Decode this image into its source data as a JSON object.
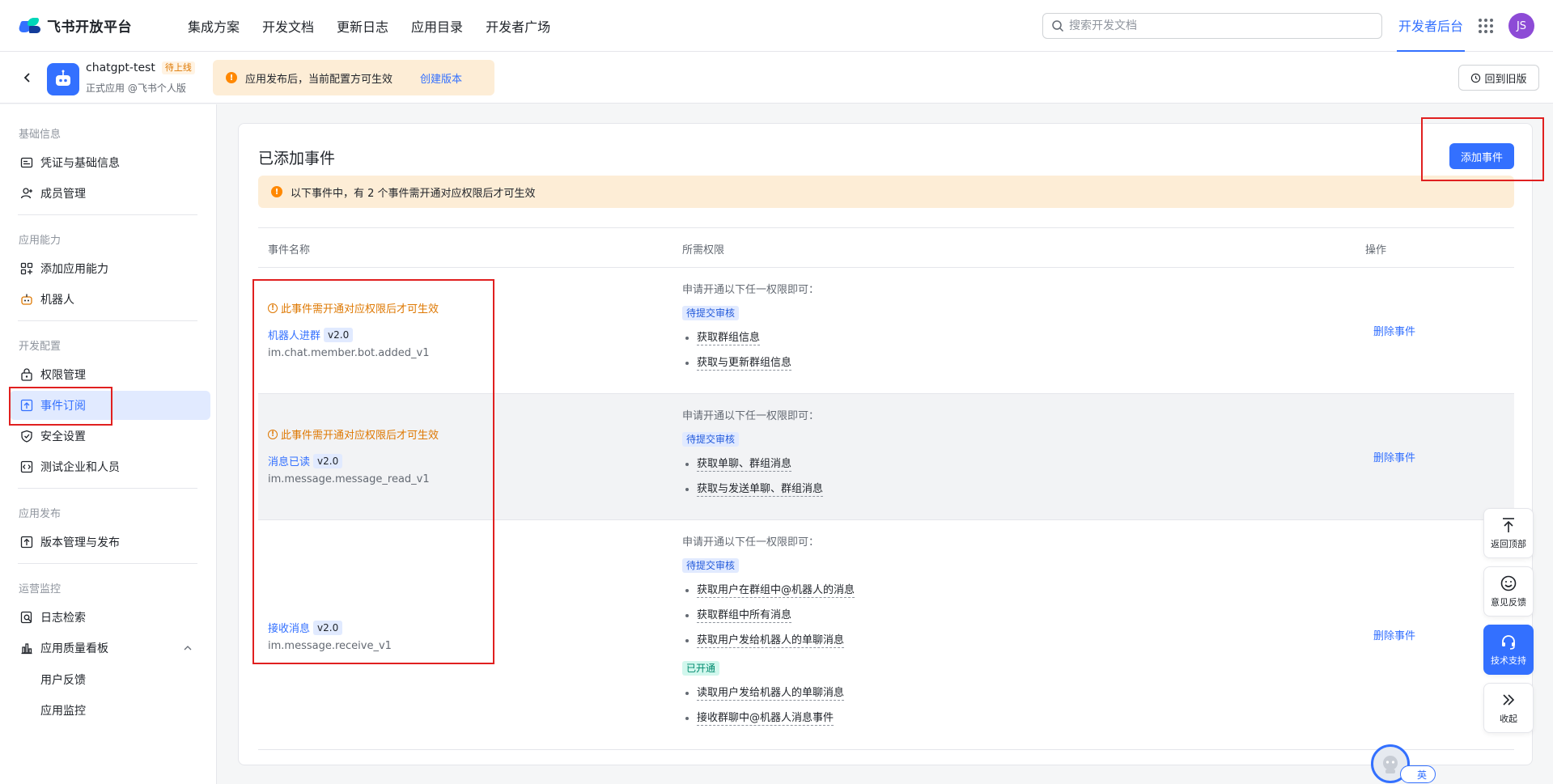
{
  "topbar": {
    "brand": "飞书开放平台",
    "nav": [
      "集成方案",
      "开发文档",
      "更新日志",
      "应用目录",
      "开发者广场"
    ],
    "search_placeholder": "搜索开发文档",
    "dev_console": "开发者后台",
    "avatar": "JS"
  },
  "app": {
    "name": "chatgpt-test",
    "status_badge": "待上线",
    "subtitle": "正式应用 @飞书个人版",
    "publish_tip": "应用发布后，当前配置方可生效",
    "create_version": "创建版本",
    "old_version": "回到旧版"
  },
  "sidebar": {
    "groups": [
      {
        "title": "基础信息",
        "items": [
          {
            "label": "凭证与基础信息",
            "icon": "credential-icon"
          },
          {
            "label": "成员管理",
            "icon": "member-icon"
          }
        ]
      },
      {
        "title": "应用能力",
        "items": [
          {
            "label": "添加应用能力",
            "icon": "add-ability-icon"
          },
          {
            "label": "机器人",
            "icon": "bot-icon"
          }
        ]
      },
      {
        "title": "开发配置",
        "items": [
          {
            "label": "权限管理",
            "icon": "lock-icon"
          },
          {
            "label": "事件订阅",
            "icon": "event-icon"
          },
          {
            "label": "安全设置",
            "icon": "shield-icon"
          },
          {
            "label": "测试企业和人员",
            "icon": "code-icon"
          }
        ]
      },
      {
        "title": "应用发布",
        "items": [
          {
            "label": "版本管理与发布",
            "icon": "upload-icon"
          }
        ]
      },
      {
        "title": "运营监控",
        "items": [
          {
            "label": "日志检索",
            "icon": "log-search-icon"
          },
          {
            "label": "应用质量看板",
            "icon": "bar-chart-icon"
          }
        ]
      }
    ],
    "sub_items": [
      "用户反馈",
      "应用监控"
    ]
  },
  "main": {
    "title": "已添加事件",
    "add_button": "添加事件",
    "notice": "以下事件中，有 2 个事件需开通对应权限后才可生效",
    "columns": [
      "事件名称",
      "所需权限",
      "操作"
    ],
    "warn_text": "此事件需开通对应权限后才可生效",
    "perm_intro": "申请开通以下任一权限即可：",
    "tag_pending": "待提交审核",
    "tag_enabled": "已开通",
    "delete_label": "删除事件",
    "events": [
      {
        "name": "机器人进群",
        "version": "v2.0",
        "code": "im.chat.member.bot.added_v1",
        "pending": [
          "获取群组信息",
          "获取与更新群组信息"
        ],
        "enabled": []
      },
      {
        "name": "消息已读",
        "version": "v2.0",
        "code": "im.message.message_read_v1",
        "pending": [
          "获取单聊、群组消息",
          "获取与发送单聊、群组消息"
        ],
        "enabled": []
      },
      {
        "name": "接收消息",
        "version": "v2.0",
        "code": "im.message.receive_v1",
        "pending": [
          "获取用户在群组中@机器人的消息",
          "获取群组中所有消息",
          "获取用户发给机器人的单聊消息"
        ],
        "enabled": [
          "读取用户发给机器人的单聊消息",
          "接收群聊中@机器人消息事件"
        ]
      }
    ]
  },
  "float_tools": {
    "top": "返回顶部",
    "feedback": "意见反馈",
    "support": "技术支持",
    "collapse": "收起"
  },
  "lang": "英",
  "colors": {
    "accent": "#3370ff",
    "warning": "#de7802",
    "annotation": "#e02020"
  }
}
